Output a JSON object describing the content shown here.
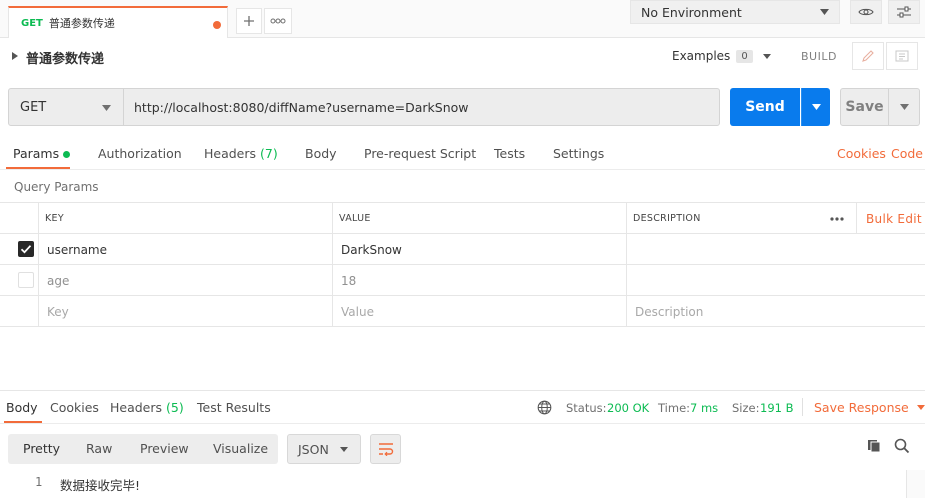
{
  "tab": {
    "method": "GET",
    "name": "普通参数传递"
  },
  "environment": {
    "selected": "No Environment"
  },
  "request": {
    "title": "普通参数传递",
    "examples_label": "Examples",
    "examples_count": "0",
    "build_label": "BUILD",
    "method": "GET",
    "url": "http://localhost:8080/diffName?username=DarkSnow",
    "send_label": "Send",
    "save_label": "Save"
  },
  "request_tabs": {
    "params": "Params",
    "authorization": "Authorization",
    "headers": "Headers",
    "headers_count": "(7)",
    "body": "Body",
    "prerequest": "Pre-request Script",
    "tests": "Tests",
    "settings": "Settings",
    "cookies": "Cookies",
    "code": "Code"
  },
  "query_params": {
    "title": "Query Params",
    "columns": {
      "key": "KEY",
      "value": "VALUE",
      "description": "DESCRIPTION"
    },
    "bulk_edit": "Bulk Edit",
    "rows": [
      {
        "checked": true,
        "key": "username",
        "value": "DarkSnow",
        "description": ""
      },
      {
        "checked": false,
        "key": "age",
        "value": "18",
        "description": ""
      }
    ],
    "placeholder": {
      "key": "Key",
      "value": "Value",
      "description": "Description"
    }
  },
  "response": {
    "tabs": {
      "body": "Body",
      "cookies": "Cookies",
      "headers": "Headers",
      "headers_count": "(5)",
      "test_results": "Test Results"
    },
    "status_label": "Status:",
    "status_value": "200 OK",
    "time_label": "Time:",
    "time_value": "7 ms",
    "size_label": "Size:",
    "size_value": "191 B",
    "save_response": "Save Response",
    "formats": {
      "pretty": "Pretty",
      "raw": "Raw",
      "preview": "Preview",
      "visualize": "Visualize"
    },
    "language": "JSON",
    "body_lines": [
      {
        "no": "1",
        "text": "数据接收完毕!"
      }
    ]
  },
  "colors": {
    "accent": "#f26b3a",
    "send": "#097bed",
    "success": "#0cbb52"
  }
}
